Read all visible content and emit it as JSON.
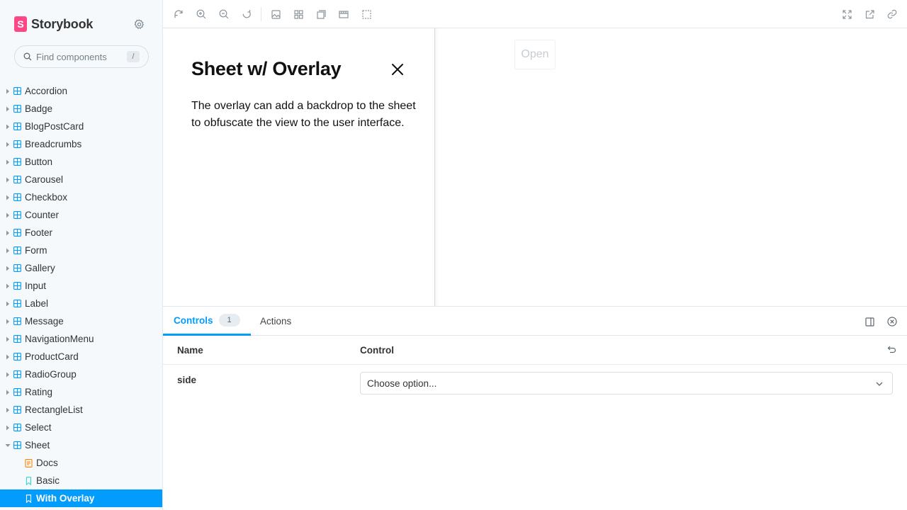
{
  "brand": {
    "name": "Storybook",
    "mark": "S"
  },
  "search": {
    "placeholder": "Find components",
    "shortcut": "/"
  },
  "sidebar": {
    "components": [
      "Accordion",
      "Badge",
      "BlogPostCard",
      "Breadcrumbs",
      "Button",
      "Carousel",
      "Checkbox",
      "Counter",
      "Footer",
      "Form",
      "Gallery",
      "Input",
      "Label",
      "Message",
      "NavigationMenu",
      "ProductCard",
      "RadioGroup",
      "Rating",
      "RectangleList",
      "Select",
      "Sheet"
    ],
    "expanded": "Sheet",
    "stories": [
      {
        "label": "Docs",
        "icon": "docs-icon"
      },
      {
        "label": "Basic",
        "icon": "story-icon"
      },
      {
        "label": "With Overlay",
        "icon": "story-icon",
        "selected": true
      }
    ]
  },
  "toolbar": {
    "icons": [
      "reload-icon",
      "zoom-in-icon",
      "zoom-out-icon",
      "zoom-reset-icon",
      "background-icon",
      "grid-icon",
      "measure-icon",
      "viewport-icon",
      "outline-icon",
      "fullscreen-icon",
      "open-new-tab-icon",
      "copy-link-icon"
    ]
  },
  "preview": {
    "sheet_title": "Sheet w/ Overlay",
    "sheet_description": "The overlay can add a backdrop to the sheet to obfuscate the view to the user interface.",
    "open_button": "Open"
  },
  "panel": {
    "tabs": [
      {
        "label": "Controls",
        "badge": "1",
        "active": true
      },
      {
        "label": "Actions"
      }
    ],
    "headers": {
      "name": "Name",
      "control": "Control"
    },
    "rows": [
      {
        "name": "side",
        "control_value": "Choose option..."
      }
    ]
  },
  "colors": {
    "accent": "#029cfd",
    "brand": "#ff4785",
    "component_icon": "#029cfd",
    "docs_icon": "#ff8300",
    "story_icon": "#37d5d3"
  }
}
